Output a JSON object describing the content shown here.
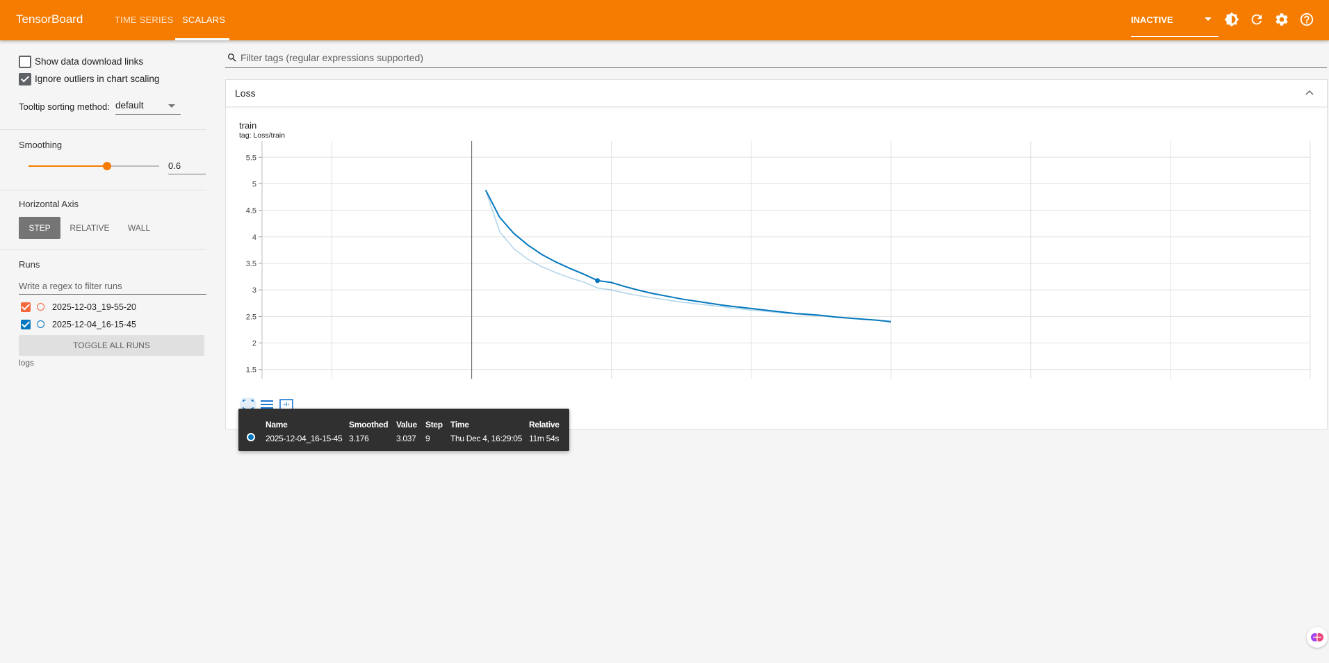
{
  "app": {
    "title": "TensorBoard"
  },
  "tabs": [
    {
      "label": "TIME SERIES",
      "active": false
    },
    {
      "label": "SCALARS",
      "active": true
    }
  ],
  "status_select": {
    "value": "INACTIVE"
  },
  "toolbar_icons": [
    "theme-icon",
    "reload-icon",
    "settings-icon",
    "help-icon"
  ],
  "sidebar": {
    "show_download_links": {
      "label": "Show data download links",
      "checked": false
    },
    "ignore_outliers": {
      "label": "Ignore outliers in chart scaling",
      "checked": true
    },
    "tooltip_sorting": {
      "label": "Tooltip sorting method:",
      "value": "default"
    },
    "smoothing": {
      "title": "Smoothing",
      "value": "0.6",
      "fraction": 0.6
    },
    "horizontal_axis": {
      "title": "Horizontal Axis",
      "options": [
        {
          "label": "STEP",
          "active": true
        },
        {
          "label": "RELATIVE",
          "active": false
        },
        {
          "label": "WALL",
          "active": false
        }
      ]
    },
    "runs": {
      "title": "Runs",
      "filter_placeholder": "Write a regex to filter runs",
      "items": [
        {
          "name": "2025-12-03_19-55-20",
          "color": "#f4673b",
          "checked": true
        },
        {
          "name": "2025-12-04_16-15-45",
          "color": "#0277bd",
          "checked": true
        }
      ],
      "toggle_label": "TOGGLE ALL RUNS",
      "logdir": "logs"
    }
  },
  "search": {
    "placeholder": "Filter tags (regular expressions supported)"
  },
  "card": {
    "title": "Loss"
  },
  "chart_data": {
    "type": "line",
    "title": "train",
    "subtitle": "tag: Loss/train",
    "xlim": [
      -15,
      60
    ],
    "ylim": [
      1.3,
      5.7
    ],
    "x_ticks": [
      -10,
      0,
      10,
      20,
      30,
      40,
      50
    ],
    "y_ticks": [
      1.5,
      2,
      2.5,
      3,
      3.5,
      4,
      4.5,
      5,
      5.5
    ],
    "grid": true,
    "series": [
      {
        "color": "#0277bd",
        "raw_x": [
          1,
          2,
          3,
          4,
          5,
          6,
          7,
          8,
          9,
          10,
          11,
          12,
          13,
          14,
          15,
          16,
          17,
          18,
          19,
          20,
          21,
          22,
          23,
          24,
          25,
          26,
          27,
          28,
          29,
          30
        ],
        "raw_y": [
          4.88,
          4.1,
          3.78,
          3.58,
          3.44,
          3.33,
          3.23,
          3.15,
          3.037,
          3.0,
          2.94,
          2.89,
          2.85,
          2.81,
          2.77,
          2.74,
          2.71,
          2.68,
          2.65,
          2.62,
          2.6,
          2.57,
          2.55,
          2.53,
          2.51,
          2.49,
          2.47,
          2.45,
          2.43,
          2.41
        ],
        "smoothed_y": [
          4.88,
          4.37,
          4.07,
          3.85,
          3.67,
          3.53,
          3.41,
          3.3,
          3.176,
          3.14,
          3.06,
          2.99,
          2.93,
          2.88,
          2.83,
          2.79,
          2.75,
          2.71,
          2.68,
          2.65,
          2.62,
          2.59,
          2.56,
          2.54,
          2.52,
          2.49,
          2.47,
          2.45,
          2.43,
          2.4
        ]
      }
    ],
    "highlight": {
      "x": 9,
      "y": 3.176
    },
    "cursor_x": 0
  },
  "tooltip": {
    "headers": {
      "name": "Name",
      "smoothed": "Smoothed",
      "value": "Value",
      "step": "Step",
      "time": "Time",
      "relative": "Relative"
    },
    "row": {
      "name": "2025-12-04_16-15-45",
      "smoothed": "3.176",
      "value": "3.037",
      "step": "9",
      "time": "Thu Dec 4, 16:29:05",
      "relative": "11m 54s",
      "color": "#0277bd"
    }
  }
}
